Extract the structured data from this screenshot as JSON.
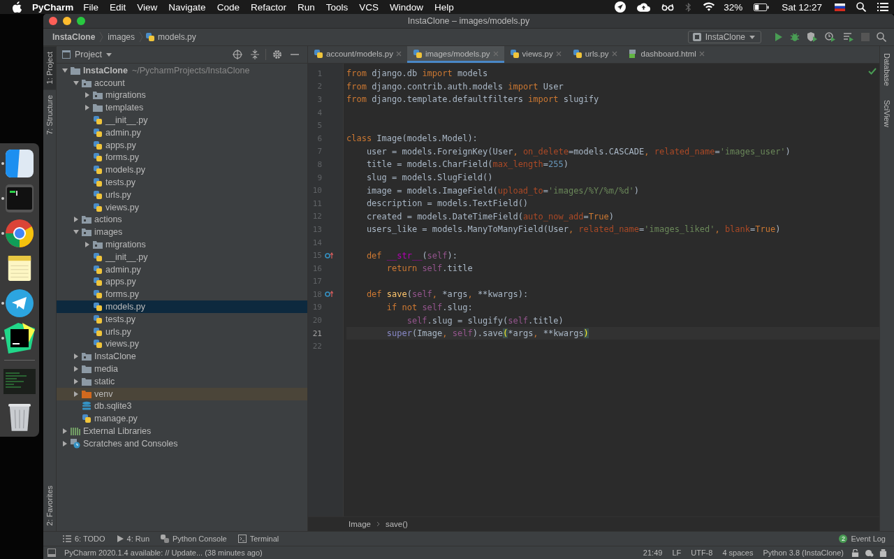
{
  "menu_bar": {
    "app_name": "PyCharm",
    "menus": [
      "File",
      "Edit",
      "View",
      "Navigate",
      "Code",
      "Refactor",
      "Run",
      "Tools",
      "VCS",
      "Window",
      "Help"
    ],
    "battery": "32%",
    "clock": "Sat 12:27"
  },
  "dock": [
    {
      "kind": "finder",
      "running": true
    },
    {
      "kind": "terminal",
      "running": true
    },
    {
      "kind": "browser",
      "running": true
    },
    {
      "kind": "notes",
      "running": false
    },
    {
      "kind": "messenger",
      "running": true
    },
    {
      "kind": "ide",
      "running": true
    },
    {
      "kind": "separator",
      "running": false
    },
    {
      "kind": "window",
      "running": false
    },
    {
      "kind": "trash",
      "running": false
    }
  ],
  "window": {
    "title": "InstaClone – images/models.py"
  },
  "breadcrumbs": [
    "InstaClone",
    "images",
    "models.py"
  ],
  "run_config": "InstaClone",
  "left_strip": {
    "top": [
      {
        "label": "1: Project",
        "selected": true
      },
      {
        "label": "7: Structure",
        "selected": false
      }
    ],
    "bottom": [
      {
        "label": "2: Favorites",
        "selected": false
      }
    ]
  },
  "project_panel": {
    "title": "Project"
  },
  "tree": [
    {
      "label": "InstaClone",
      "path": "~/PycharmProjects/InstaClone",
      "kind": "project",
      "expanded": true,
      "selected": false,
      "children": [
        {
          "label": "account",
          "kind": "package",
          "expanded": true,
          "selected": false,
          "children": [
            {
              "label": "migrations",
              "kind": "package",
              "expanded": false,
              "selected": false
            },
            {
              "label": "templates",
              "kind": "folder",
              "expanded": false,
              "selected": false
            },
            {
              "label": "__init__.py",
              "kind": "python",
              "selected": false
            },
            {
              "label": "admin.py",
              "kind": "python",
              "selected": false
            },
            {
              "label": "apps.py",
              "kind": "python",
              "selected": false
            },
            {
              "label": "forms.py",
              "kind": "python",
              "selected": false
            },
            {
              "label": "models.py",
              "kind": "python",
              "selected": false
            },
            {
              "label": "tests.py",
              "kind": "python",
              "selected": false
            },
            {
              "label": "urls.py",
              "kind": "python",
              "selected": false
            },
            {
              "label": "views.py",
              "kind": "python",
              "selected": false
            }
          ]
        },
        {
          "label": "actions",
          "kind": "package",
          "expanded": false,
          "selected": false
        },
        {
          "label": "images",
          "kind": "package",
          "expanded": true,
          "selected": false,
          "children": [
            {
              "label": "migrations",
              "kind": "package",
              "expanded": false,
              "selected": false
            },
            {
              "label": "__init__.py",
              "kind": "python",
              "selected": false
            },
            {
              "label": "admin.py",
              "kind": "python",
              "selected": false
            },
            {
              "label": "apps.py",
              "kind": "python",
              "selected": false
            },
            {
              "label": "forms.py",
              "kind": "python",
              "selected": false
            },
            {
              "label": "models.py",
              "kind": "python",
              "selected": true
            },
            {
              "label": "tests.py",
              "kind": "python",
              "selected": false
            },
            {
              "label": "urls.py",
              "kind": "python",
              "selected": false
            },
            {
              "label": "views.py",
              "kind": "python",
              "selected": false
            }
          ]
        },
        {
          "label": "InstaClone",
          "kind": "package",
          "expanded": false,
          "selected": false
        },
        {
          "label": "media",
          "kind": "folder",
          "expanded": false,
          "selected": false
        },
        {
          "label": "static",
          "kind": "folder",
          "expanded": false,
          "selected": false
        },
        {
          "label": "venv",
          "kind": "excluded",
          "expanded": false,
          "selected": false
        },
        {
          "label": "db.sqlite3",
          "kind": "database",
          "selected": false
        },
        {
          "label": "manage.py",
          "kind": "python",
          "selected": false
        }
      ]
    },
    {
      "label": "External Libraries",
      "kind": "libraries",
      "expanded": false,
      "selected": false
    },
    {
      "label": "Scratches and Consoles",
      "kind": "scratches",
      "expanded": false,
      "selected": false
    }
  ],
  "tabs": [
    {
      "label": "account/models.py",
      "kind": "python",
      "selected": false
    },
    {
      "label": "images/models.py",
      "kind": "python",
      "selected": true
    },
    {
      "label": "views.py",
      "kind": "python",
      "selected": false
    },
    {
      "label": "urls.py",
      "kind": "python",
      "selected": false
    },
    {
      "label": "dashboard.html",
      "kind": "html",
      "selected": false
    }
  ],
  "code_lines": [
    {
      "number": "1",
      "marker": false,
      "current": false,
      "tokens": [
        {
          "text": "from",
          "kind": "keyword"
        },
        {
          "text": " django.db ",
          "kind": "plain"
        },
        {
          "text": "import",
          "kind": "keyword"
        },
        {
          "text": " models",
          "kind": "plain"
        }
      ]
    },
    {
      "number": "2",
      "marker": false,
      "current": false,
      "tokens": [
        {
          "text": "from",
          "kind": "keyword"
        },
        {
          "text": " django.contrib.auth.models ",
          "kind": "plain"
        },
        {
          "text": "import",
          "kind": "keyword"
        },
        {
          "text": " User",
          "kind": "plain"
        }
      ]
    },
    {
      "number": "3",
      "marker": false,
      "current": false,
      "tokens": [
        {
          "text": "from",
          "kind": "keyword"
        },
        {
          "text": " django.template.defaultfilters ",
          "kind": "plain"
        },
        {
          "text": "import",
          "kind": "keyword"
        },
        {
          "text": " slugify",
          "kind": "plain"
        }
      ]
    },
    {
      "number": "4",
      "marker": false,
      "current": false
    },
    {
      "number": "5",
      "marker": false,
      "current": false
    },
    {
      "number": "6",
      "marker": false,
      "current": false,
      "tokens": [
        {
          "text": "class",
          "kind": "keyword"
        },
        {
          "text": " Image(models.Model):",
          "kind": "plain"
        }
      ]
    },
    {
      "number": "7",
      "marker": false,
      "current": false,
      "tokens": [
        {
          "text": "    user = models.ForeignKey(User",
          "kind": "plain"
        },
        {
          "text": ", ",
          "kind": "keyword"
        },
        {
          "text": "on_delete",
          "kind": "param"
        },
        {
          "text": "=models.CASCADE",
          "kind": "plain"
        },
        {
          "text": ", ",
          "kind": "keyword"
        },
        {
          "text": "related_name",
          "kind": "param"
        },
        {
          "text": "=",
          "kind": "plain"
        },
        {
          "text": "'images_user'",
          "kind": "string"
        },
        {
          "text": ")",
          "kind": "plain"
        }
      ]
    },
    {
      "number": "8",
      "marker": false,
      "current": false,
      "tokens": [
        {
          "text": "    title = models.CharField(",
          "kind": "plain"
        },
        {
          "text": "max_length",
          "kind": "param"
        },
        {
          "text": "=",
          "kind": "plain"
        },
        {
          "text": "255",
          "kind": "number"
        },
        {
          "text": ")",
          "kind": "plain"
        }
      ]
    },
    {
      "number": "9",
      "marker": false,
      "current": false,
      "tokens": [
        {
          "text": "    slug = models.SlugField()",
          "kind": "plain"
        }
      ]
    },
    {
      "number": "10",
      "marker": false,
      "current": false,
      "tokens": [
        {
          "text": "    image = models.ImageField(",
          "kind": "plain"
        },
        {
          "text": "upload_to",
          "kind": "param"
        },
        {
          "text": "=",
          "kind": "plain"
        },
        {
          "text": "'images/%Y/%m/%d'",
          "kind": "string"
        },
        {
          "text": ")",
          "kind": "plain"
        }
      ]
    },
    {
      "number": "11",
      "marker": false,
      "current": false,
      "tokens": [
        {
          "text": "    description = models.TextField()",
          "kind": "plain"
        }
      ]
    },
    {
      "number": "12",
      "marker": false,
      "current": false,
      "tokens": [
        {
          "text": "    created = models.DateTimeField(",
          "kind": "plain"
        },
        {
          "text": "auto_now_add",
          "kind": "param"
        },
        {
          "text": "=",
          "kind": "plain"
        },
        {
          "text": "True",
          "kind": "keyword"
        },
        {
          "text": ")",
          "kind": "plain"
        }
      ]
    },
    {
      "number": "13",
      "marker": false,
      "current": false,
      "tokens": [
        {
          "text": "    users_like = models.ManyToManyField(User",
          "kind": "plain"
        },
        {
          "text": ", ",
          "kind": "keyword"
        },
        {
          "text": "related_name",
          "kind": "param"
        },
        {
          "text": "=",
          "kind": "plain"
        },
        {
          "text": "'images_liked'",
          "kind": "string"
        },
        {
          "text": ", ",
          "kind": "keyword"
        },
        {
          "text": "blank",
          "kind": "param"
        },
        {
          "text": "=",
          "kind": "plain"
        },
        {
          "text": "True",
          "kind": "keyword"
        },
        {
          "text": ")",
          "kind": "plain"
        }
      ]
    },
    {
      "number": "14",
      "marker": false,
      "current": false
    },
    {
      "number": "15",
      "marker": true,
      "current": false,
      "tokens": [
        {
          "text": "    def",
          "kind": "keyword"
        },
        {
          "text": " __str__",
          "kind": "magic"
        },
        {
          "text": "(",
          "kind": "plain"
        },
        {
          "text": "self",
          "kind": "self"
        },
        {
          "text": "):",
          "kind": "plain"
        }
      ]
    },
    {
      "number": "16",
      "marker": false,
      "current": false,
      "tokens": [
        {
          "text": "        return",
          "kind": "keyword"
        },
        {
          "text": " self",
          "kind": "self"
        },
        {
          "text": ".title",
          "kind": "plain"
        }
      ]
    },
    {
      "number": "17",
      "marker": false,
      "current": false
    },
    {
      "number": "18",
      "marker": true,
      "current": false,
      "tokens": [
        {
          "text": "    def",
          "kind": "keyword"
        },
        {
          "text": " save",
          "kind": "function"
        },
        {
          "text": "(",
          "kind": "plain"
        },
        {
          "text": "self",
          "kind": "self"
        },
        {
          "text": ", ",
          "kind": "keyword"
        },
        {
          "text": "*args",
          "kind": "plain"
        },
        {
          "text": ", ",
          "kind": "keyword"
        },
        {
          "text": "**kwargs):",
          "kind": "plain"
        }
      ]
    },
    {
      "number": "19",
      "marker": false,
      "current": false,
      "tokens": [
        {
          "text": "        if not",
          "kind": "keyword"
        },
        {
          "text": " self",
          "kind": "self"
        },
        {
          "text": ".slug:",
          "kind": "plain"
        }
      ]
    },
    {
      "number": "20",
      "marker": false,
      "current": false,
      "tokens": [
        {
          "text": "            self",
          "kind": "self"
        },
        {
          "text": ".slug = slugify(",
          "kind": "plain"
        },
        {
          "text": "self",
          "kind": "self"
        },
        {
          "text": ".title)",
          "kind": "plain"
        }
      ]
    },
    {
      "number": "21",
      "marker": false,
      "current": true,
      "tokens": [
        {
          "text": "        super",
          "kind": "builtin"
        },
        {
          "text": "(Image",
          "kind": "plain"
        },
        {
          "text": ", ",
          "kind": "keyword"
        },
        {
          "text": "self",
          "kind": "self"
        },
        {
          "text": ").save",
          "kind": "plain"
        },
        {
          "text": "(",
          "kind": "bracket"
        },
        {
          "text": "*args",
          "kind": "plain"
        },
        {
          "text": ", ",
          "kind": "keyword"
        },
        {
          "text": "**kwargs",
          "kind": "plain"
        },
        {
          "text": ")",
          "kind": "bracket"
        }
      ]
    },
    {
      "number": "22",
      "marker": false,
      "current": false
    }
  ],
  "editor_breadcrumbs": [
    "Image",
    "save()"
  ],
  "right_strip": [
    "Database",
    "SciView"
  ],
  "tool_buttons": [
    "6: TODO",
    "4: Run",
    "Python Console",
    "Terminal"
  ],
  "event_log": {
    "label": "Event Log",
    "count": "2"
  },
  "status_bar": {
    "message": "PyCharm 2020.1.4 available: // Update... (38 minutes ago)",
    "items": [
      "21:49",
      "LF",
      "UTF-8",
      "4 spaces",
      "Python 3.8 (InstaClone)"
    ]
  }
}
